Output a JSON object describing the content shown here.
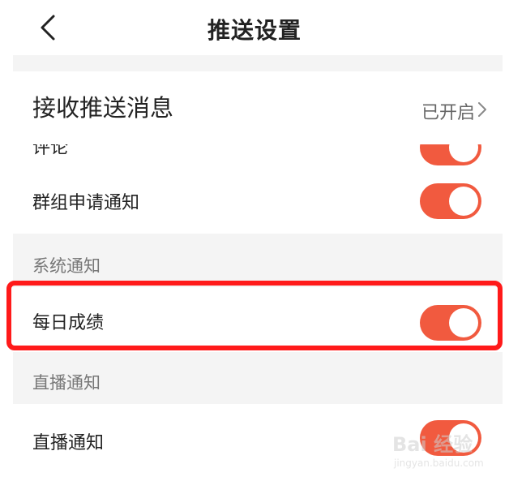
{
  "header": {
    "title": "推送设置"
  },
  "receive": {
    "label": "接收推送消息",
    "status": "已开启"
  },
  "rows": {
    "comment_label": "评论",
    "group_label": "群组申请通知",
    "daily_label": "每日成绩",
    "live_label": "直播通知"
  },
  "sections": {
    "system": "系统通知",
    "live": "直播通知"
  },
  "toggles": {
    "comment_on": true,
    "group_on": true,
    "daily_on": true,
    "live_on": true
  },
  "colors": {
    "toggle_on": "#f15a3f",
    "highlight": "#ff1a1a"
  },
  "watermark": {
    "text": "Bai 经验",
    "sub": "jingyan.baidu.com"
  }
}
